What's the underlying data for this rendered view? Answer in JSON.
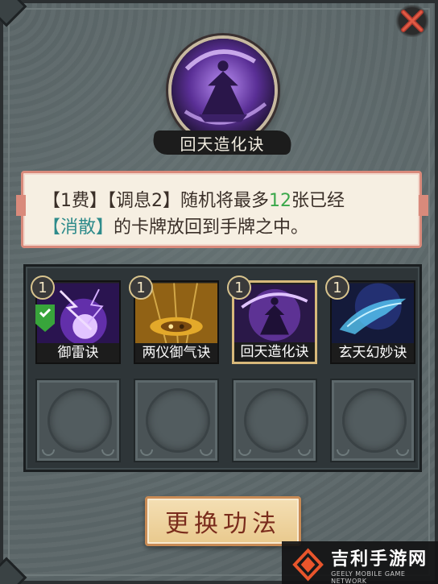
{
  "hero": {
    "title": "回天造化诀",
    "icon": "purple-robed-figure-skill-art"
  },
  "description": {
    "part1": "【1费】【调息2】随机将最多",
    "number": "12",
    "part2": "张已经",
    "keyword": "【消散】",
    "part3": "的卡牌放回到手牌之中。",
    "highlight_color": "#2e8b8b",
    "number_color": "#3aa84a"
  },
  "deck": {
    "cards": [
      {
        "name": "御雷诀",
        "cost": "1",
        "selected": true,
        "icon": "purple-lightning-skill-art"
      },
      {
        "name": "两仪御气诀",
        "cost": "1",
        "selected": false,
        "icon": "golden-yin-yang-skill-art"
      },
      {
        "name": "回天造化诀",
        "cost": "1",
        "selected": false,
        "active": true,
        "icon": "purple-robed-figure-skill-art"
      },
      {
        "name": "玄天幻妙诀",
        "cost": "1",
        "selected": false,
        "icon": "blue-spirit-beast-skill-art"
      }
    ],
    "empty_slots": 4
  },
  "action": {
    "label": "更换功法"
  },
  "watermark": {
    "name": "吉利手游网",
    "tagline": "GEELY MOBILE GAME NETWORK"
  },
  "colors": {
    "accent": "#d98a7b",
    "button_text": "#7a2c1c",
    "check": "#38a53b"
  }
}
